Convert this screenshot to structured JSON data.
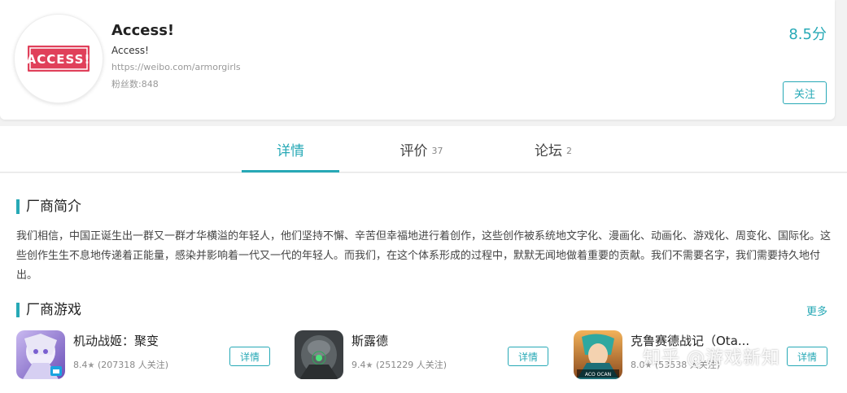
{
  "vendor": {
    "name": "Access!",
    "subtitle": "Access!",
    "url": "https://weibo.com/armorgirls",
    "fans": "粉丝数:848",
    "score": "8.5分",
    "follow_label": "关注",
    "logo_text": "ACCESS!"
  },
  "tabs": [
    {
      "label": "详情",
      "count": ""
    },
    {
      "label": "评价",
      "count": "37"
    },
    {
      "label": "论坛",
      "count": "2"
    }
  ],
  "intro": {
    "title": "厂商简介",
    "text": "我们相信，中国正诞生出一群又一群才华横溢的年轻人，他们坚持不懈、辛苦但幸福地进行着创作，这些创作被系统地文字化、漫画化、动画化、游戏化、周变化、国际化。这些创作生生不息地传递着正能量，感染并影响着一代又一代的年轻人。而我们，在这个体系形成的过程中，默默无闻地做着重要的贡献。我们不需要名字，我们需要持久地付出。"
  },
  "games": {
    "title": "厂商游戏",
    "more": "更多",
    "detail_label": "详情",
    "items": [
      {
        "name": "机动战姬：聚变",
        "rating": "8.4",
        "followers": "(207318 人关注)"
      },
      {
        "name": "斯露德",
        "rating": "9.4",
        "followers": "(251229 人关注)"
      },
      {
        "name": "克鲁赛德战记（Ota...",
        "rating": "8.0",
        "followers": "(53538 人关注)"
      }
    ]
  },
  "watermark": "知乎 @游戏新知",
  "colors": {
    "accent": "#27a9b6",
    "logo_red": "#e0405a"
  }
}
